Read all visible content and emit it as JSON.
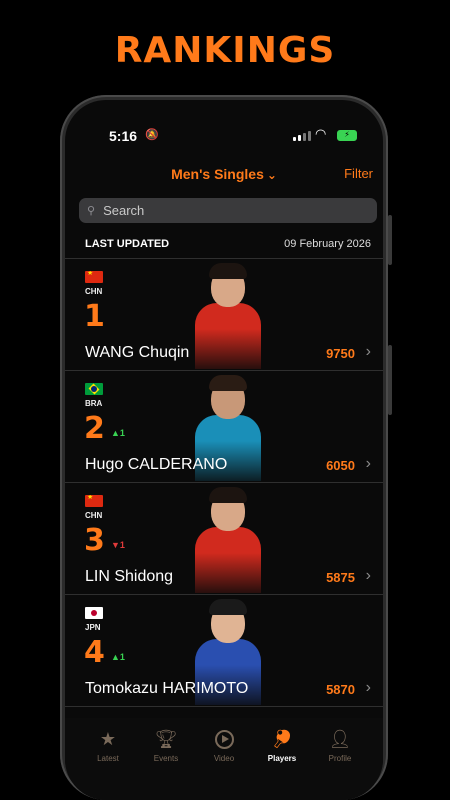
{
  "headline": "RANKINGS",
  "status_bar": {
    "time": "5:16"
  },
  "header": {
    "category": "Men's Singles",
    "filter": "Filter"
  },
  "search": {
    "placeholder": "Search"
  },
  "last_updated": {
    "label": "LAST UPDATED",
    "date": "09 February 2026"
  },
  "rankings": [
    {
      "country": "CHN",
      "rank": "1",
      "movement": "",
      "name": "WANG Chuqin",
      "points": "9750"
    },
    {
      "country": "BRA",
      "rank": "2",
      "movement": "▲1",
      "name": "Hugo CALDERANO",
      "points": "6050"
    },
    {
      "country": "CHN",
      "rank": "3",
      "movement": "▼1",
      "name": "LIN Shidong",
      "points": "5875"
    },
    {
      "country": "JPN",
      "rank": "4",
      "movement": "▲1",
      "name": "Tomokazu HARIMOTO",
      "points": "5870"
    }
  ],
  "tabs": [
    {
      "label": "Latest",
      "icon": "star-icon"
    },
    {
      "label": "Events",
      "icon": "trophy-icon"
    },
    {
      "label": "Video",
      "icon": "play-icon"
    },
    {
      "label": "Players",
      "icon": "paddle-icon",
      "active": true
    },
    {
      "label": "Profile",
      "icon": "person-icon"
    }
  ],
  "colors": {
    "accent": "#ff7a1a",
    "up": "#39d353",
    "down": "#e03a3a",
    "background": "#0a0a0a"
  }
}
